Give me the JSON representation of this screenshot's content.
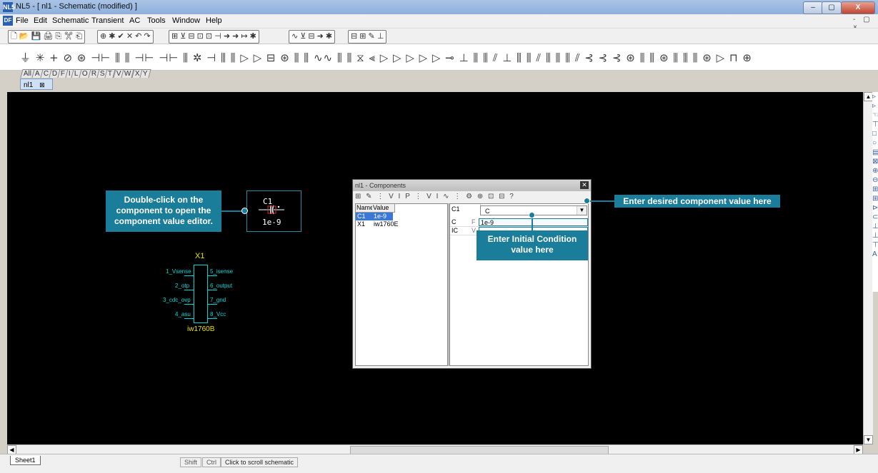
{
  "window": {
    "title": "NL5 - [ nl1 - Schematic (modified) ]",
    "app_icon": "NL5",
    "min": "–",
    "max": "▢",
    "close": "X"
  },
  "menu": [
    {
      "label": "File"
    },
    {
      "label": "Edit"
    },
    {
      "label": "Schematic"
    },
    {
      "label": "Transient"
    },
    {
      "label": "AC"
    },
    {
      "label": "Tools"
    },
    {
      "label": "Window"
    },
    {
      "label": "Help"
    }
  ],
  "mdi_buttons": "- ▢ ×",
  "toolbar1": {
    "file_group": "🗋 📂 💾 🖨 ⎘ ✂ ⎗",
    "edit_group": "⊕ ✱ ✔ ✕ ↶ ↷",
    "view_group": "⊞ ⊻ ⊟ ⊡ ⊡ ⊣ ➜ ➜ ↦ ✱",
    "transient_group": "∿ ⊻ ⊟ ➜ ✱",
    "ac_group": "⊟ ⊞ ✎ ⊥"
  },
  "symbol_bar": "⏚ ✳ + ⊘ ⊛ ⊣⊢ ⫼ ⫼ ⊣⊢ ⊣⊢ ⫼ ✲ ⊣ ⫼ ⫼ ▷ ▷ ⊟ ⊛ ⫼ ⫼ ∿∿ ⫼ ⫼ ⧖ ⫷ ▷ ▷ ▷ ▷ ▷ ⊸ ⊥ ⫼ ⫼ ⫽ ⊥ ⫼ ⫼ ⫽ ⫼ ⫼ ⫼ ⫽ ⊰ ⊰ ⊰ ⊛ ⫼ ⫼ ⊛ ⫼ ⫼ ⫼ ⊛ ▷ ⊓ ⊕",
  "category_tabs": [
    "All",
    "A",
    "C",
    "D",
    "F",
    "I",
    "L",
    "O",
    "R",
    "S",
    "T",
    "V",
    "W",
    "X",
    "Y"
  ],
  "doc_tab": {
    "label": "nl1"
  },
  "canvas": {
    "c1": {
      "label": "C1",
      "value": "1e-9"
    },
    "x1": {
      "label": "X1",
      "part": "iw1760B",
      "pins_left": [
        "1_Vsense",
        "2_otp",
        "3_cdc_ovp",
        "4_asu"
      ],
      "pins_right": [
        "5_isense",
        "6_output",
        "7_gnd",
        "8_Vcc"
      ]
    }
  },
  "callouts": {
    "double_click": "Double-click on the component to open the component value editor.",
    "value": "Enter desired component value here",
    "ic": "Enter Initial Condition value here"
  },
  "components_dialog": {
    "title": "nl1 - Components",
    "close": "✕",
    "tools": "⊞ ✎ ⋮ V I P ⋮ V I ∿ ⋮ ⚙ ⊕ ⊡ ⊟ ?",
    "list_headers": {
      "name": "Name",
      "value": "Value"
    },
    "rows": [
      {
        "name": "C1",
        "value": "1e-9",
        "selected": true
      },
      {
        "name": "X1",
        "value": "iw1760E",
        "selected": false
      }
    ],
    "selected_name": "C1",
    "type_value": "C",
    "type_arrow": "▼",
    "props": [
      {
        "name": "C",
        "unit": "F",
        "value": "1e-9"
      },
      {
        "name": "IC",
        "unit": "V",
        "value": ""
      }
    ]
  },
  "statusbar": {
    "sheet_tab": "Sheet1",
    "shift": "Shift",
    "ctrl": "Ctrl",
    "message": "Click to scroll schematic"
  },
  "colors": {
    "callout": "#1a7d9a",
    "canvas": "#000000",
    "wire": "#00d8d8",
    "label": "#e8e000"
  }
}
